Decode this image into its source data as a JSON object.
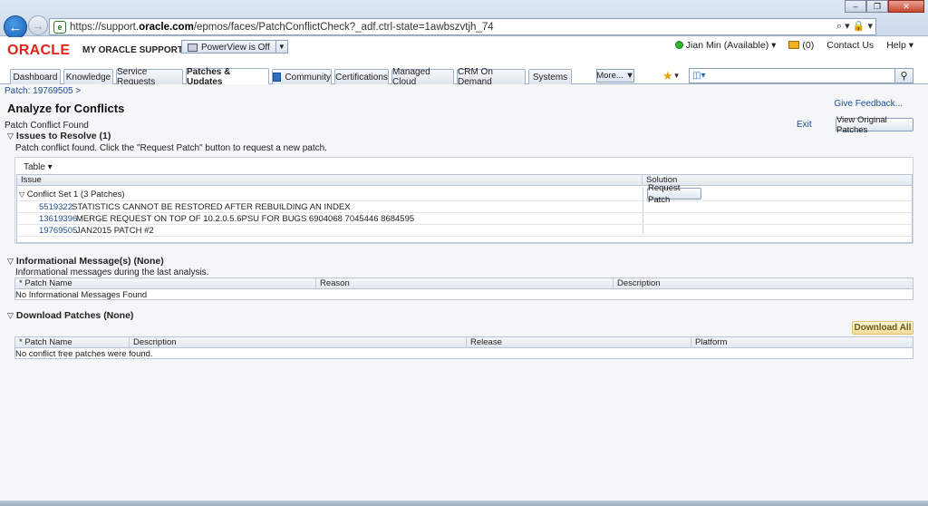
{
  "browser": {
    "url_prefix": "https://support.",
    "url_domain": "oracle.com",
    "url_suffix": "/epmos/faces/PatchConflictCheck?_adf.ctrl-state=1awbszvtjh_74",
    "tools": "⌕ ▾ 🔒 ▾",
    "window_buttons": [
      "–",
      "❐",
      "✕"
    ]
  },
  "header": {
    "logo": "ORACLE",
    "product": "MY ORACLE SUPPORT",
    "powerview_label": "PowerView is Off",
    "user": "Jian Min (Available)",
    "messages": "(0)",
    "contact": "Contact Us",
    "help": "Help"
  },
  "tabs": [
    "Dashboard",
    "Knowledge",
    "Service Requests",
    "Patches & Updates",
    "Community",
    "Certifications",
    "Managed Cloud",
    "CRM On Demand",
    "Systems"
  ],
  "tabbar": {
    "more_label": "More..."
  },
  "breadcrumb": "Patch: 19769505 >",
  "page": {
    "title": "Analyze for Conflicts",
    "subtitle": "Patch Conflict Found",
    "feedback": "Give Feedback...",
    "exit": "Exit",
    "view_original": "View Original Patches"
  },
  "issues": {
    "heading": "Issues to Resolve (1)",
    "description": "Patch conflict found. Click the \"Request Patch\" button to request a new patch.",
    "table_menu": "Table",
    "columns": [
      "Issue",
      "Solution"
    ],
    "conflict_set": "Conflict Set 1 (3 Patches)",
    "request_button": "Request Patch",
    "patches": [
      {
        "id": "5519322",
        "desc": "STATISTICS CANNOT BE RESTORED AFTER REBUILDING AN INDEX"
      },
      {
        "id": "13619396",
        "desc": "MERGE REQUEST ON TOP OF 10.2.0.5.6PSU FOR BUGS 6904068 7045446 8684595"
      },
      {
        "id": "19769505",
        "desc": "JAN2015 PATCH #2"
      }
    ]
  },
  "informational": {
    "heading": "Informational Message(s) (None)",
    "description": "Informational messages during the last analysis.",
    "columns": [
      "* Patch Name",
      "Reason",
      "Description"
    ],
    "empty": "No Informational Messages Found"
  },
  "download": {
    "heading": "Download Patches (None)",
    "button": "Download All",
    "columns": [
      "* Patch Name",
      "Description",
      "Release",
      "Platform"
    ],
    "empty": "No conflict free patches were found."
  }
}
